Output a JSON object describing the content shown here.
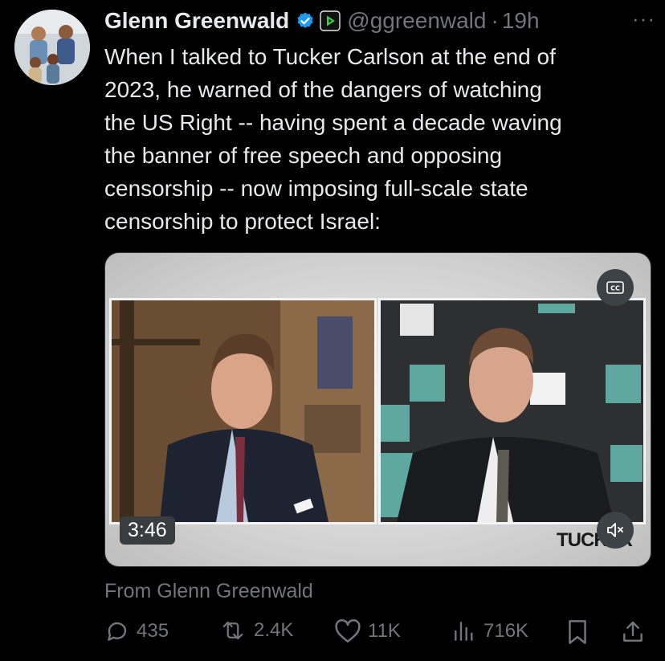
{
  "author": {
    "name": "Glenn Greenwald",
    "handle": "@ggreenwald",
    "separator": "·",
    "time": "19h"
  },
  "tweet": {
    "text": "When I talked to Tucker Carlson at the end of\n2023, he warned of the dangers of watching\nthe US Right -- having spent a decade waving\nthe banner of free speech and opposing\ncensorship -- now imposing full-scale state\ncensorship to protect Israel:"
  },
  "video": {
    "duration": "3:46",
    "cc_label": "CC",
    "watermark": "TUCKER"
  },
  "source": "From Glenn Greenwald",
  "metrics": {
    "replies": "435",
    "reposts": "2.4K",
    "likes": "11K",
    "views": "716K"
  },
  "more_label": "···",
  "colors": {
    "background": "#000000",
    "text": "#e7e9ea",
    "muted": "#71767b",
    "verified": "#1d9bf0",
    "affiliation": "#3bd24d"
  },
  "icons": [
    "verified-badge-icon",
    "rumble-affiliation-icon",
    "more-icon",
    "cc-icon",
    "mute-icon",
    "reply-icon",
    "repost-icon",
    "like-icon",
    "views-icon",
    "bookmark-icon",
    "share-icon"
  ]
}
